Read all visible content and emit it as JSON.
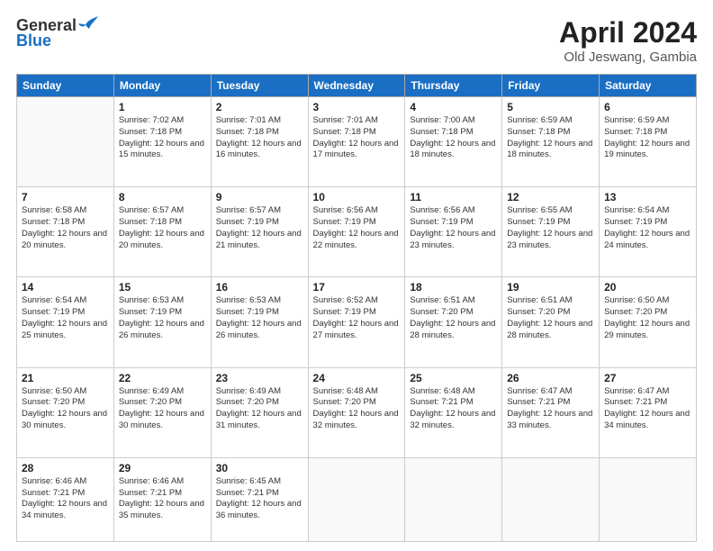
{
  "header": {
    "logo_general": "General",
    "logo_blue": "Blue",
    "title": "April 2024",
    "location": "Old Jeswang, Gambia"
  },
  "days_of_week": [
    "Sunday",
    "Monday",
    "Tuesday",
    "Wednesday",
    "Thursday",
    "Friday",
    "Saturday"
  ],
  "weeks": [
    [
      {
        "day": "",
        "sunrise": "",
        "sunset": "",
        "daylight": ""
      },
      {
        "day": "1",
        "sunrise": "Sunrise: 7:02 AM",
        "sunset": "Sunset: 7:18 PM",
        "daylight": "Daylight: 12 hours and 15 minutes."
      },
      {
        "day": "2",
        "sunrise": "Sunrise: 7:01 AM",
        "sunset": "Sunset: 7:18 PM",
        "daylight": "Daylight: 12 hours and 16 minutes."
      },
      {
        "day": "3",
        "sunrise": "Sunrise: 7:01 AM",
        "sunset": "Sunset: 7:18 PM",
        "daylight": "Daylight: 12 hours and 17 minutes."
      },
      {
        "day": "4",
        "sunrise": "Sunrise: 7:00 AM",
        "sunset": "Sunset: 7:18 PM",
        "daylight": "Daylight: 12 hours and 18 minutes."
      },
      {
        "day": "5",
        "sunrise": "Sunrise: 6:59 AM",
        "sunset": "Sunset: 7:18 PM",
        "daylight": "Daylight: 12 hours and 18 minutes."
      },
      {
        "day": "6",
        "sunrise": "Sunrise: 6:59 AM",
        "sunset": "Sunset: 7:18 PM",
        "daylight": "Daylight: 12 hours and 19 minutes."
      }
    ],
    [
      {
        "day": "7",
        "sunrise": "Sunrise: 6:58 AM",
        "sunset": "Sunset: 7:18 PM",
        "daylight": "Daylight: 12 hours and 20 minutes."
      },
      {
        "day": "8",
        "sunrise": "Sunrise: 6:57 AM",
        "sunset": "Sunset: 7:18 PM",
        "daylight": "Daylight: 12 hours and 20 minutes."
      },
      {
        "day": "9",
        "sunrise": "Sunrise: 6:57 AM",
        "sunset": "Sunset: 7:19 PM",
        "daylight": "Daylight: 12 hours and 21 minutes."
      },
      {
        "day": "10",
        "sunrise": "Sunrise: 6:56 AM",
        "sunset": "Sunset: 7:19 PM",
        "daylight": "Daylight: 12 hours and 22 minutes."
      },
      {
        "day": "11",
        "sunrise": "Sunrise: 6:56 AM",
        "sunset": "Sunset: 7:19 PM",
        "daylight": "Daylight: 12 hours and 23 minutes."
      },
      {
        "day": "12",
        "sunrise": "Sunrise: 6:55 AM",
        "sunset": "Sunset: 7:19 PM",
        "daylight": "Daylight: 12 hours and 23 minutes."
      },
      {
        "day": "13",
        "sunrise": "Sunrise: 6:54 AM",
        "sunset": "Sunset: 7:19 PM",
        "daylight": "Daylight: 12 hours and 24 minutes."
      }
    ],
    [
      {
        "day": "14",
        "sunrise": "Sunrise: 6:54 AM",
        "sunset": "Sunset: 7:19 PM",
        "daylight": "Daylight: 12 hours and 25 minutes."
      },
      {
        "day": "15",
        "sunrise": "Sunrise: 6:53 AM",
        "sunset": "Sunset: 7:19 PM",
        "daylight": "Daylight: 12 hours and 26 minutes."
      },
      {
        "day": "16",
        "sunrise": "Sunrise: 6:53 AM",
        "sunset": "Sunset: 7:19 PM",
        "daylight": "Daylight: 12 hours and 26 minutes."
      },
      {
        "day": "17",
        "sunrise": "Sunrise: 6:52 AM",
        "sunset": "Sunset: 7:19 PM",
        "daylight": "Daylight: 12 hours and 27 minutes."
      },
      {
        "day": "18",
        "sunrise": "Sunrise: 6:51 AM",
        "sunset": "Sunset: 7:20 PM",
        "daylight": "Daylight: 12 hours and 28 minutes."
      },
      {
        "day": "19",
        "sunrise": "Sunrise: 6:51 AM",
        "sunset": "Sunset: 7:20 PM",
        "daylight": "Daylight: 12 hours and 28 minutes."
      },
      {
        "day": "20",
        "sunrise": "Sunrise: 6:50 AM",
        "sunset": "Sunset: 7:20 PM",
        "daylight": "Daylight: 12 hours and 29 minutes."
      }
    ],
    [
      {
        "day": "21",
        "sunrise": "Sunrise: 6:50 AM",
        "sunset": "Sunset: 7:20 PM",
        "daylight": "Daylight: 12 hours and 30 minutes."
      },
      {
        "day": "22",
        "sunrise": "Sunrise: 6:49 AM",
        "sunset": "Sunset: 7:20 PM",
        "daylight": "Daylight: 12 hours and 30 minutes."
      },
      {
        "day": "23",
        "sunrise": "Sunrise: 6:49 AM",
        "sunset": "Sunset: 7:20 PM",
        "daylight": "Daylight: 12 hours and 31 minutes."
      },
      {
        "day": "24",
        "sunrise": "Sunrise: 6:48 AM",
        "sunset": "Sunset: 7:20 PM",
        "daylight": "Daylight: 12 hours and 32 minutes."
      },
      {
        "day": "25",
        "sunrise": "Sunrise: 6:48 AM",
        "sunset": "Sunset: 7:21 PM",
        "daylight": "Daylight: 12 hours and 32 minutes."
      },
      {
        "day": "26",
        "sunrise": "Sunrise: 6:47 AM",
        "sunset": "Sunset: 7:21 PM",
        "daylight": "Daylight: 12 hours and 33 minutes."
      },
      {
        "day": "27",
        "sunrise": "Sunrise: 6:47 AM",
        "sunset": "Sunset: 7:21 PM",
        "daylight": "Daylight: 12 hours and 34 minutes."
      }
    ],
    [
      {
        "day": "28",
        "sunrise": "Sunrise: 6:46 AM",
        "sunset": "Sunset: 7:21 PM",
        "daylight": "Daylight: 12 hours and 34 minutes."
      },
      {
        "day": "29",
        "sunrise": "Sunrise: 6:46 AM",
        "sunset": "Sunset: 7:21 PM",
        "daylight": "Daylight: 12 hours and 35 minutes."
      },
      {
        "day": "30",
        "sunrise": "Sunrise: 6:45 AM",
        "sunset": "Sunset: 7:21 PM",
        "daylight": "Daylight: 12 hours and 36 minutes."
      },
      {
        "day": "",
        "sunrise": "",
        "sunset": "",
        "daylight": ""
      },
      {
        "day": "",
        "sunrise": "",
        "sunset": "",
        "daylight": ""
      },
      {
        "day": "",
        "sunrise": "",
        "sunset": "",
        "daylight": ""
      },
      {
        "day": "",
        "sunrise": "",
        "sunset": "",
        "daylight": ""
      }
    ]
  ]
}
